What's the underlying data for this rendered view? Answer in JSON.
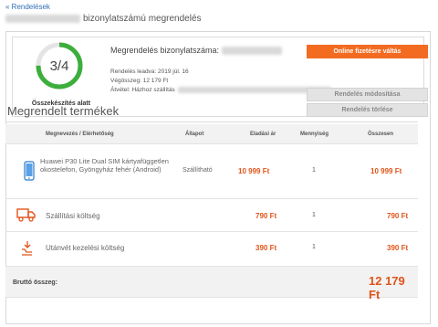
{
  "nav": {
    "back_label": "« Rendelések"
  },
  "page": {
    "title_suffix": "bizonylatszámú megrendelés"
  },
  "summary": {
    "progress_text": "3/4",
    "progress_fraction": 0.75,
    "status_caption": "Összekészítés alatt",
    "order_number_label": "Megrendelés bizonylatszáma:",
    "order_date_line": "Rendelés leadva: 2019 júl. 16",
    "total_line": "Végösszeg: 12 179 Ft",
    "delivery_line": "Átvétel: Házhoz szállítás",
    "buttons": {
      "pay": "Online fizetésre váltás",
      "modify": "Rendelés módosítása",
      "delete": "Rendelés törlése"
    }
  },
  "products": {
    "section_title": "Megrendelt termékek",
    "columns": {
      "name": "Megnevezés / Elérhetőség",
      "state": "Állapot",
      "price": "Eladási ár",
      "qty": "Mennyiség",
      "total": "Összesen"
    },
    "items": [
      {
        "icon": "smartphone-icon",
        "name": "Huawei P30 Lite Dual SIM kártyafüggetlen okostelefon, Gyöngyház fehér (Android)",
        "state": "Szállítható",
        "price": "10 999 Ft",
        "qty": "1",
        "total": "10 999 Ft"
      },
      {
        "icon": "delivery-truck-icon",
        "name": "Szállítási költség",
        "price": "790 Ft",
        "qty": "1",
        "total": "790 Ft"
      },
      {
        "icon": "cash-on-delivery-icon",
        "name": "Utánvét kezelési költség",
        "price": "390 Ft",
        "qty": "1",
        "total": "390 Ft"
      }
    ],
    "gross_label": "Bruttó összeg:",
    "gross_value": "12 179 Ft"
  },
  "colors": {
    "accent": "#f26b21",
    "progress": "#3cae3c",
    "price": "#e0541a"
  }
}
